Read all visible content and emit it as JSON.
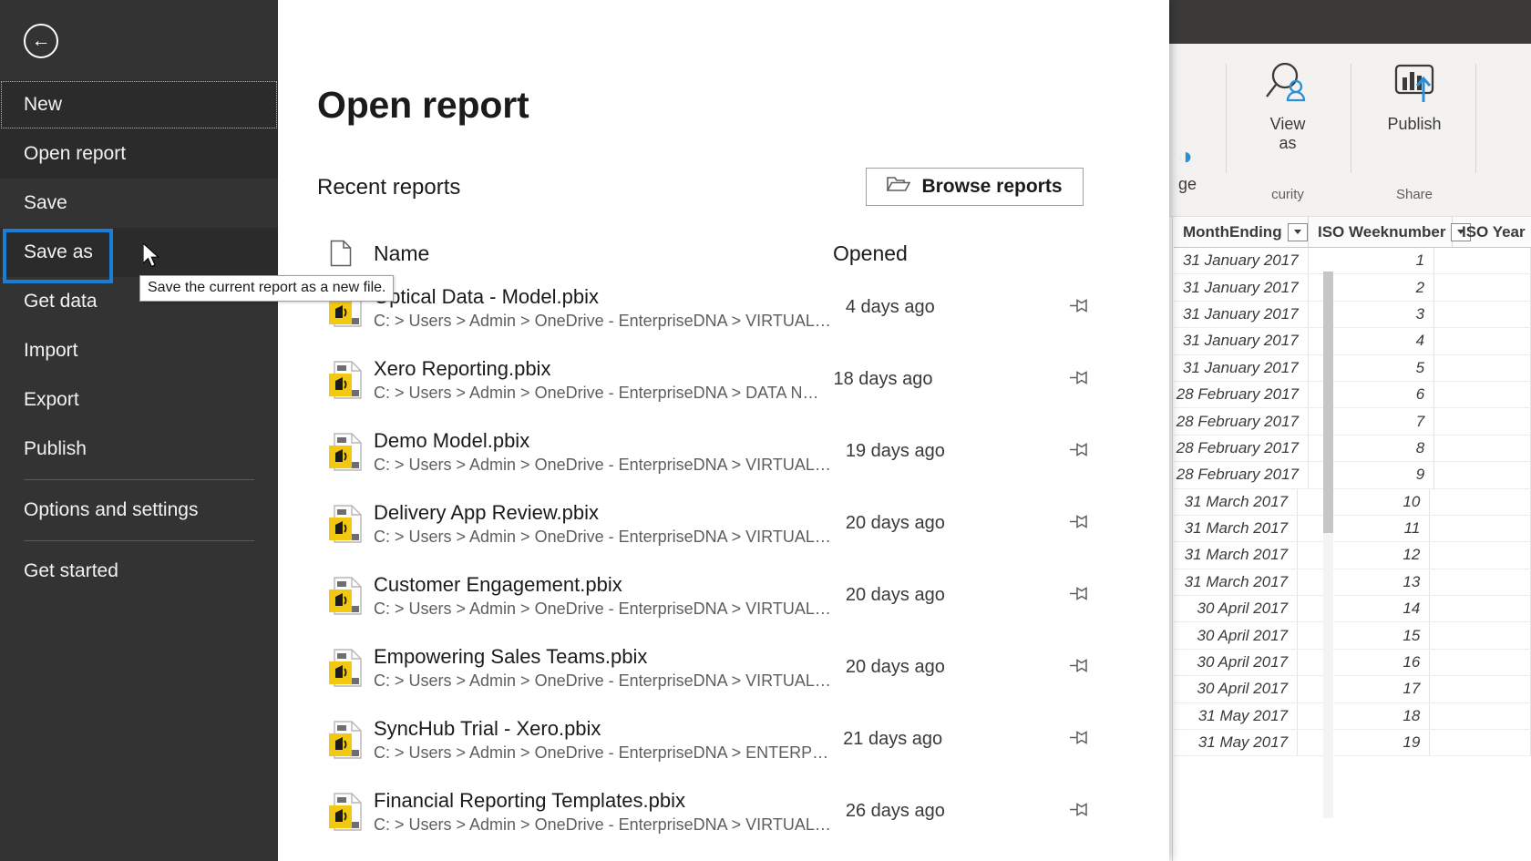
{
  "backstage": {
    "back_button_label": "Back",
    "nav_items": [
      {
        "label": "New",
        "state": "focus-dotted"
      },
      {
        "label": "Open report",
        "state": "active"
      },
      {
        "label": "Save",
        "state": "normal"
      },
      {
        "label": "Save as",
        "state": "selected"
      },
      {
        "label": "Get data",
        "state": "normal"
      },
      {
        "label": "Import",
        "state": "normal"
      },
      {
        "label": "Export",
        "state": "normal"
      },
      {
        "label": "Publish",
        "state": "normal"
      },
      {
        "label": "Options and settings",
        "state": "normal"
      },
      {
        "label": "Get started",
        "state": "normal"
      }
    ],
    "tooltip": "Save the current report as a new file.",
    "page_title": "Open report",
    "section_label": "Recent reports",
    "browse_button": "Browse reports",
    "columns": {
      "name": "Name",
      "opened": "Opened"
    },
    "recent_reports": [
      {
        "name": "Optical Data - Model.pbix",
        "path": "C: > Users > Admin > OneDrive - EnterpriseDNA > VIRTUAL…",
        "opened": "4 days ago"
      },
      {
        "name": "Xero Reporting.pbix",
        "path": "C: > Users > Admin > OneDrive - EnterpriseDNA > DATA N…",
        "opened": "18 days ago"
      },
      {
        "name": "Demo Model.pbix",
        "path": "C: > Users > Admin > OneDrive - EnterpriseDNA > VIRTUAL…",
        "opened": "19 days ago"
      },
      {
        "name": "Delivery App Review.pbix",
        "path": "C: > Users > Admin > OneDrive - EnterpriseDNA > VIRTUAL…",
        "opened": "20 days ago"
      },
      {
        "name": "Customer Engagement.pbix",
        "path": "C: > Users > Admin > OneDrive - EnterpriseDNA > VIRTUAL…",
        "opened": "20 days ago"
      },
      {
        "name": "Empowering Sales Teams.pbix",
        "path": "C: > Users > Admin > OneDrive - EnterpriseDNA > VIRTUAL…",
        "opened": "20 days ago"
      },
      {
        "name": "SyncHub Trial - Xero.pbix",
        "path": "C: > Users > Admin > OneDrive - EnterpriseDNA > ENTERP…",
        "opened": "21 days ago"
      },
      {
        "name": "Financial Reporting Templates.pbix",
        "path": "C: > Users > Admin > OneDrive - EnterpriseDNA > VIRTUAL…",
        "opened": "26 days ago"
      }
    ]
  },
  "ribbon": {
    "partial_button": "ge",
    "view_as_label": "View\nas",
    "view_as_line1": "View",
    "view_as_line2": "as",
    "publish_label": "Publish",
    "group_security": "curity",
    "group_share": "Share"
  },
  "grid": {
    "columns": [
      "MonthEnding",
      "ISO Weeknumber",
      "ISO Year"
    ],
    "rows": [
      {
        "month_ending": "31 January 2017",
        "iso_weeknumber": "1"
      },
      {
        "month_ending": "31 January 2017",
        "iso_weeknumber": "2"
      },
      {
        "month_ending": "31 January 2017",
        "iso_weeknumber": "3"
      },
      {
        "month_ending": "31 January 2017",
        "iso_weeknumber": "4"
      },
      {
        "month_ending": "31 January 2017",
        "iso_weeknumber": "5"
      },
      {
        "month_ending": "28 February 2017",
        "iso_weeknumber": "6"
      },
      {
        "month_ending": "28 February 2017",
        "iso_weeknumber": "7"
      },
      {
        "month_ending": "28 February 2017",
        "iso_weeknumber": "8"
      },
      {
        "month_ending": "28 February 2017",
        "iso_weeknumber": "9"
      },
      {
        "month_ending": "31 March 2017",
        "iso_weeknumber": "10"
      },
      {
        "month_ending": "31 March 2017",
        "iso_weeknumber": "11"
      },
      {
        "month_ending": "31 March 2017",
        "iso_weeknumber": "12"
      },
      {
        "month_ending": "31 March 2017",
        "iso_weeknumber": "13"
      },
      {
        "month_ending": "30 April 2017",
        "iso_weeknumber": "14"
      },
      {
        "month_ending": "30 April 2017",
        "iso_weeknumber": "15"
      },
      {
        "month_ending": "30 April 2017",
        "iso_weeknumber": "16"
      },
      {
        "month_ending": "30 April 2017",
        "iso_weeknumber": "17"
      },
      {
        "month_ending": "31 May 2017",
        "iso_weeknumber": "18"
      },
      {
        "month_ending": "31 May 2017",
        "iso_weeknumber": "19"
      }
    ]
  },
  "colors": {
    "nav_bg": "#333333",
    "nav_active": "#2b2b2b",
    "selection_outline": "#1a7fd4",
    "titlebar": "#3b3a39",
    "ribbon_bg": "#f3f2f1",
    "accent_blue": "#2a8fd4",
    "file_icon_yellow": "#f2c811"
  }
}
